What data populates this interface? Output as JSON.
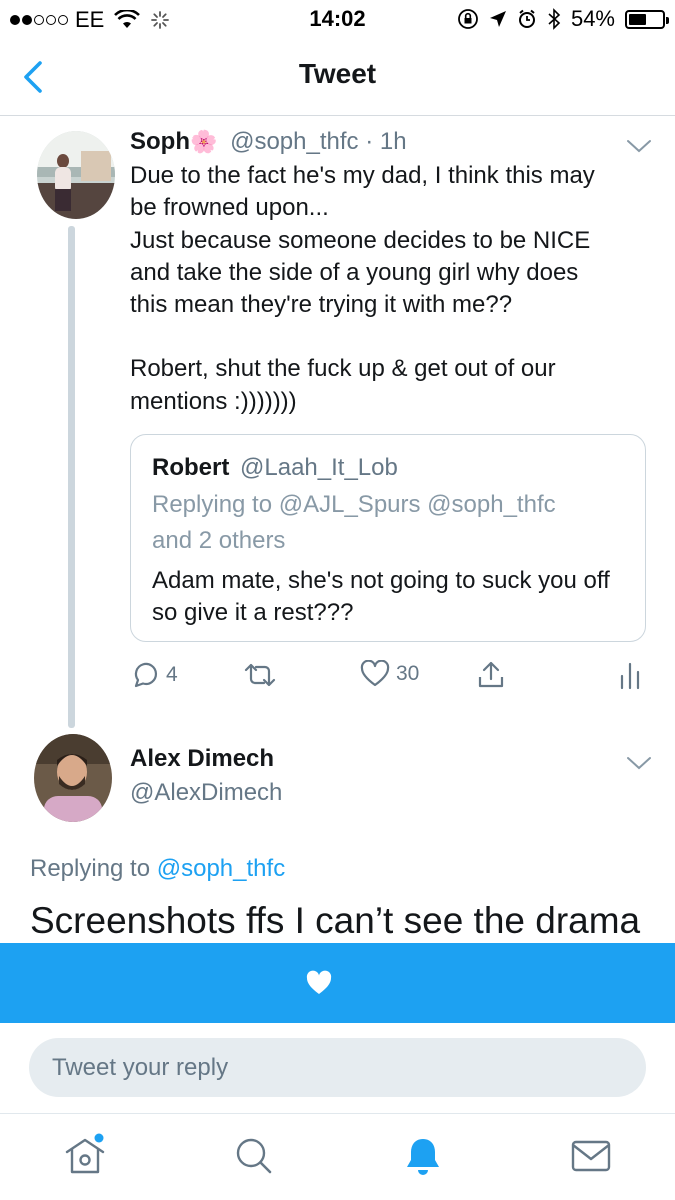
{
  "status_bar": {
    "carrier": "EE",
    "time": "14:02",
    "battery": "54%",
    "battery_level": 0.54
  },
  "nav": {
    "title": "Tweet",
    "back_icon": "chevron-left-icon"
  },
  "main_tweet": {
    "name": "Soph",
    "name_emoji": "🌸",
    "handle": "@soph_thfc",
    "time": "· 1h",
    "lines": [
      "Due to the fact he's my dad, I think this may",
      "be frowned upon...",
      "Just because someone decides to be NICE",
      "and take the side of a young girl why does",
      "this mean they're trying it with me??"
    ],
    "lines2": [
      "Robert, shut the fuck up & get out of our",
      "mentions :)))))))"
    ],
    "quoted": {
      "name": "Robert",
      "handle": "@Laah_It_Lob",
      "replying_to": "Replying to @AJL_Spurs @soph_thfc",
      "replying_to_2": "and 2 others",
      "text": "Adam mate, she's not going to suck you off so give it a rest???"
    },
    "actions": {
      "reply_count": "4",
      "retweet_count": "",
      "like_count": "30"
    }
  },
  "reply_tweet": {
    "name": "Alex Dimech",
    "handle": "@AlexDimech",
    "replying_label": "Replying to ",
    "replying_handle": "@soph_thfc",
    "text": "Screenshots ffs I can’t see the drama"
  },
  "reply_box": {
    "placeholder": "Tweet your reply"
  },
  "colors": {
    "accent": "#1da1f2",
    "muted": "#657786",
    "border": "#ccd6dd"
  }
}
